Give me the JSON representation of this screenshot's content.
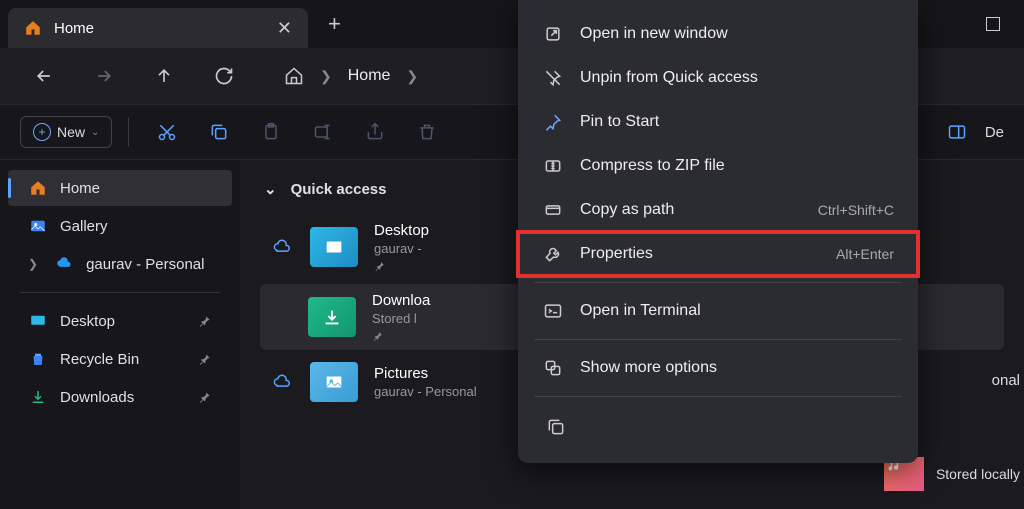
{
  "tab": {
    "title": "Home"
  },
  "breadcrumb": {
    "segment": "Home"
  },
  "toolbar": {
    "new_label": "New",
    "details_fragment": "De"
  },
  "sidebar": {
    "home": "Home",
    "gallery": "Gallery",
    "onedrive": "gaurav - Personal",
    "desktop": "Desktop",
    "recycle": "Recycle Bin",
    "downloads": "Downloads"
  },
  "content": {
    "section": "Quick access",
    "items": [
      {
        "name": "Desktop",
        "sub": "gaurav -"
      },
      {
        "name": "Downloa",
        "sub": "Stored l"
      },
      {
        "name": "Pictures",
        "sub": "gaurav - Personal"
      }
    ],
    "right_sub_fragment": "onal",
    "stored_locally": "Stored locally"
  },
  "context_menu": {
    "open_new_window": "Open in new window",
    "unpin": "Unpin from Quick access",
    "pin_start": "Pin to Start",
    "compress": "Compress to ZIP file",
    "copy_path": "Copy as path",
    "copy_path_shortcut": "Ctrl+Shift+C",
    "properties": "Properties",
    "properties_shortcut": "Alt+Enter",
    "terminal": "Open in Terminal",
    "more": "Show more options"
  }
}
